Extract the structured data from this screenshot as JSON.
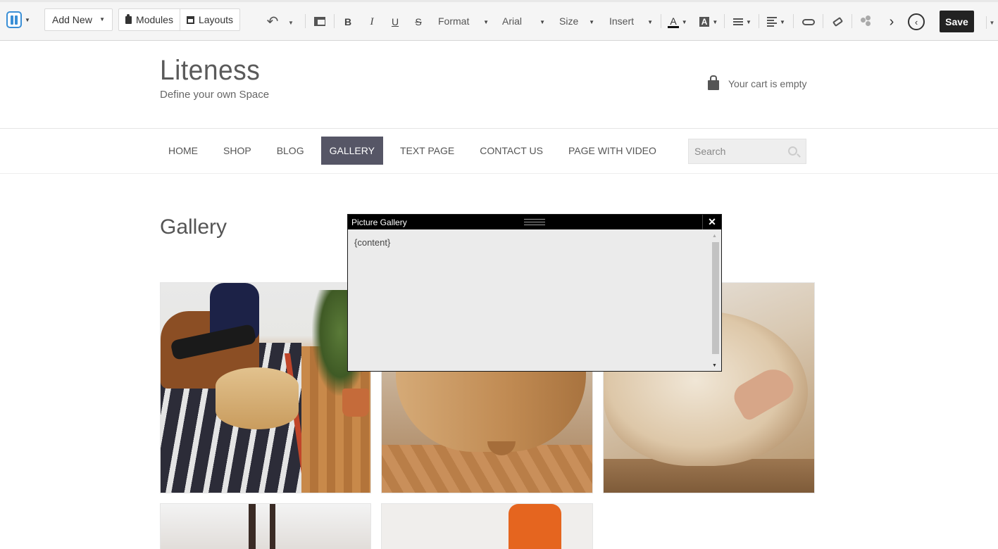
{
  "toolbar": {
    "add_new": "Add New",
    "modules": "Modules",
    "layouts": "Layouts",
    "bold": "B",
    "italic": "I",
    "underline": "U",
    "strike": "S",
    "format": "Format",
    "font": "Arial",
    "size": "Size",
    "insert": "Insert",
    "text_color_letter": "A",
    "bg_color_letter": "A",
    "save": "Save"
  },
  "site": {
    "title": "Liteness",
    "tagline": "Define your own Space",
    "cart_text": "Your cart is empty"
  },
  "nav": {
    "items": [
      {
        "label": "HOME",
        "active": false
      },
      {
        "label": "SHOP",
        "active": false
      },
      {
        "label": "BLOG",
        "active": false
      },
      {
        "label": "GALLERY",
        "active": true
      },
      {
        "label": "TEXT PAGE",
        "active": false
      },
      {
        "label": "CONTACT US",
        "active": false
      },
      {
        "label": "PAGE WITH VIDEO",
        "active": false
      }
    ],
    "search_placeholder": "Search"
  },
  "page": {
    "heading": "Gallery"
  },
  "dialog": {
    "title": "Picture Gallery",
    "body": "{content}"
  },
  "colors": {
    "active_nav": "#565666",
    "save_button": "#222222",
    "dialog_header": "#000000",
    "editor_blue": "#3a8fd6"
  }
}
